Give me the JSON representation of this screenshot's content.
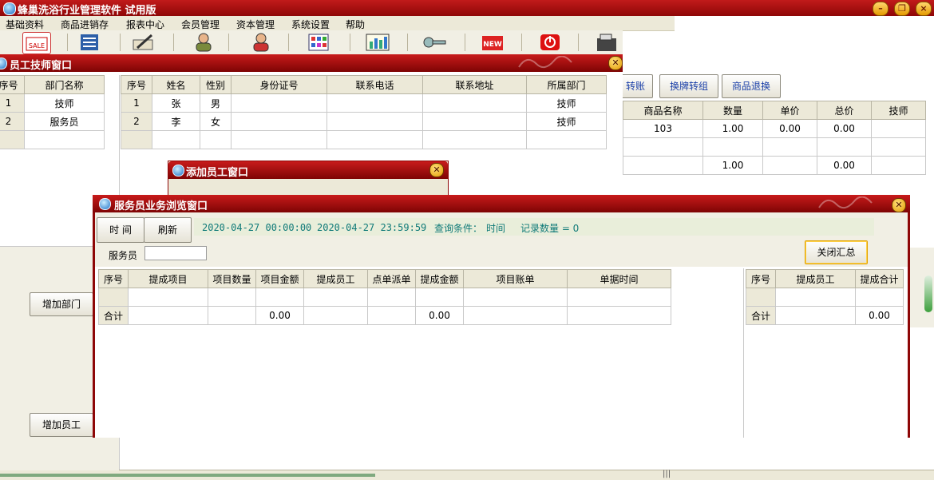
{
  "app": {
    "title": "蜂巢洗浴行业管理软件  试用版",
    "min": "–",
    "restore": "❐",
    "close": "×"
  },
  "menu": [
    "基础资料",
    "商品进销存",
    "报表中心",
    "会员管理",
    "资本管理",
    "系统设置",
    "帮助"
  ],
  "staff_window": {
    "title": "员工技师窗口",
    "dept_headers": [
      "序号",
      "部门名称"
    ],
    "dept_rows": [
      [
        "1",
        "技师"
      ],
      [
        "2",
        "服务员"
      ]
    ],
    "emp_headers": [
      "序号",
      "姓名",
      "性别",
      "身份证号",
      "联系电话",
      "联系地址",
      "所属部门"
    ],
    "emp_rows": [
      [
        "1",
        "张",
        "男",
        "",
        "",
        "",
        "技师"
      ],
      [
        "2",
        "李",
        "女",
        "",
        "",
        "",
        "技师"
      ]
    ],
    "add_dept": "增加部门",
    "add_emp": "增加员工"
  },
  "bg_panel": {
    "buttons": [
      "转账",
      "换牌转组",
      "商品退换"
    ],
    "headers": [
      "商品名称",
      "数量",
      "单价",
      "总价",
      "技师"
    ],
    "rows": [
      [
        "103",
        "1.00",
        "0.00",
        "0.00",
        ""
      ],
      [
        "",
        "",
        "",
        "",
        ""
      ],
      [
        "",
        "1.00",
        "",
        "0.00",
        ""
      ]
    ]
  },
  "add_employee_window": {
    "title": "添加员工窗口"
  },
  "browse_window": {
    "title": "服务员业务浏览窗口",
    "time_btn": "时 间",
    "refresh_btn": "刷新",
    "start_time": "2020-04-27 00:00:00",
    "end_time": "2020-04-27 23:59:59",
    "query_label": "查询条件：",
    "query_value": "时间",
    "record_count": "记录数量 = 0",
    "waiter_label": "服务员",
    "close_summary": "关闭汇总",
    "main_headers": [
      "序号",
      "提成项目",
      "项目数量",
      "项目金额",
      "提成员工",
      "点单派单",
      "提成金额",
      "项目账单",
      "单据时间"
    ],
    "main_total_label": "合计",
    "main_total_amount": "0.00",
    "main_total_commission": "0.00",
    "side_headers": [
      "序号",
      "提成员工",
      "提成合计"
    ],
    "side_total_label": "合计",
    "side_total": "0.00"
  }
}
